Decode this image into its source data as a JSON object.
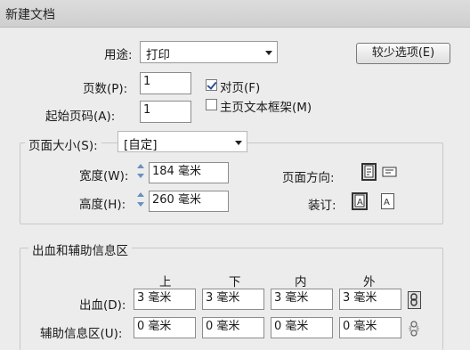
{
  "window": {
    "title": "新建文档"
  },
  "purpose": {
    "label": "用途:",
    "value": "打印"
  },
  "fewer_options_button": "较少选项(E)",
  "pages": {
    "label": "页数(P):",
    "value": "1"
  },
  "facing_pages": {
    "label": "对页(F)",
    "checked": true
  },
  "start_page": {
    "label": "起始页码(A):",
    "value": "1"
  },
  "master_text_frame": {
    "label": "主页文本框架(M)",
    "checked": false
  },
  "page_size": {
    "label": "页面大小(S):",
    "value": "[自定]",
    "width_label": "宽度(W):",
    "width_value": "184 毫米",
    "height_label": "高度(H):",
    "height_value": "260 毫米",
    "orientation_label": "页面方向:",
    "binding_label": "装订:"
  },
  "bleed_slug": {
    "section_label": "出血和辅助信息区",
    "columns": [
      "上",
      "下",
      "内",
      "外"
    ],
    "bleed_label": "出血(D):",
    "bleed_values": [
      "3 毫米",
      "3 毫米",
      "3 毫米",
      "3 毫米"
    ],
    "slug_label": "辅助信息区(U):",
    "slug_values": [
      "0 毫米",
      "0 毫米",
      "0 毫米",
      "0 毫米"
    ]
  },
  "icons": {
    "orientation_portrait": "portrait-page-icon",
    "orientation_landscape": "landscape-page-icon",
    "binding_left": "binding-left-to-right-icon",
    "binding_right": "binding-right-to-left-icon",
    "link_bleed": "chain-link-icon",
    "link_slug": "chain-link-broken-icon"
  }
}
